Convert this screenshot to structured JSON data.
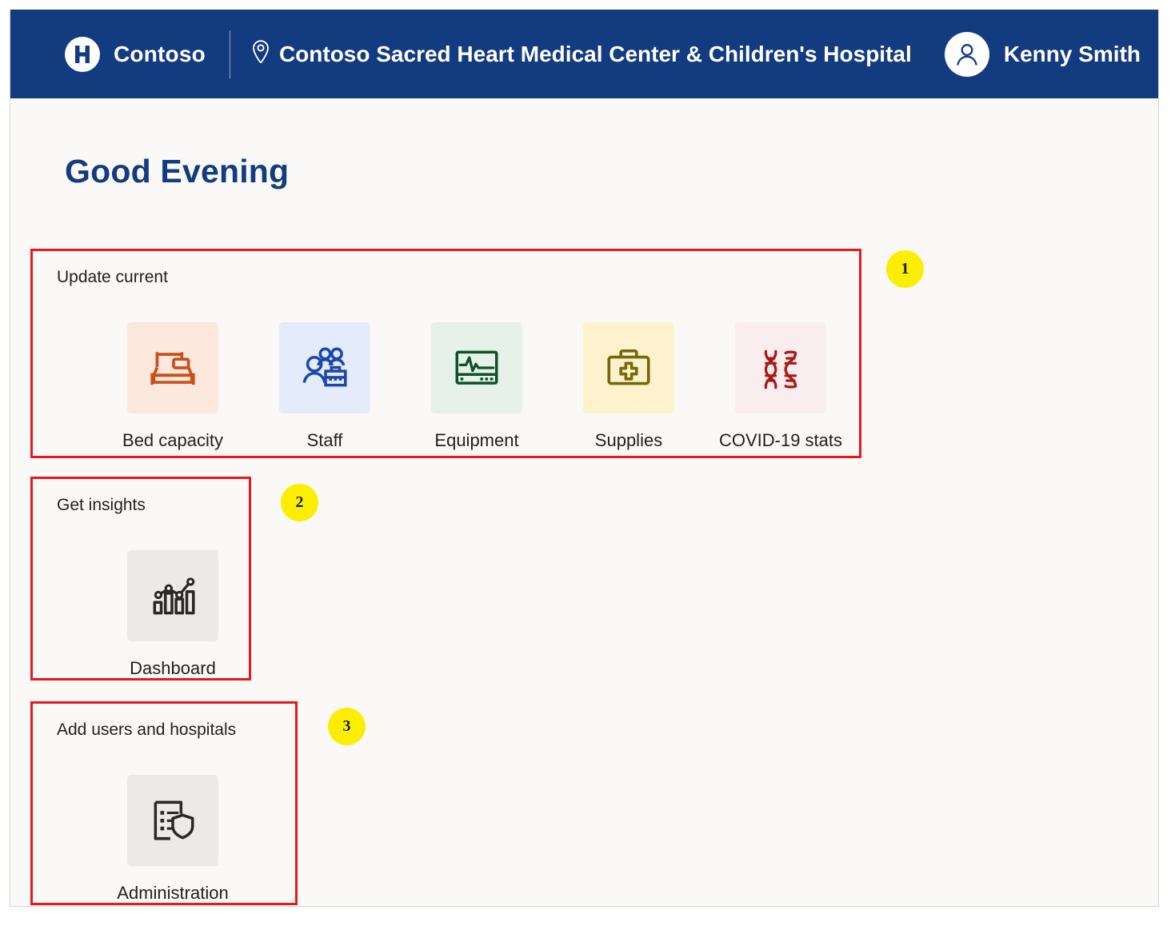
{
  "topbar": {
    "logo_icon": "hospital-h-logo-icon",
    "brand": "Contoso",
    "location_icon": "map-pin-icon",
    "facility": "Contoso Sacred Heart Medical Center & Children's Hospital",
    "avatar_icon": "person-avatar-icon",
    "user": "Kenny Smith",
    "bg_color": "#123b80"
  },
  "page": {
    "greeting": "Good Evening",
    "greeting_color": "#123b80",
    "bg_color": "#faf9f8"
  },
  "sections": [
    {
      "title": "Update current",
      "tiles": [
        {
          "label": "Bed capacity",
          "icon": "hospital-bed-icon",
          "icon_color": "#c8511b",
          "tile_color": "#fce8dc"
        },
        {
          "label": "Staff",
          "icon": "staff-people-icon",
          "icon_color": "#1b47a8",
          "tile_color": "#e4ebfa"
        },
        {
          "label": "Equipment",
          "icon": "vitals-monitor-icon",
          "icon_color": "#0d5227",
          "tile_color": "#e6f1ea"
        },
        {
          "label": "Supplies",
          "icon": "medical-kit-icon",
          "icon_color": "#77680a",
          "tile_color": "#fcf2cd"
        },
        {
          "label": "COVID-19 stats",
          "icon": "dna-helix-icon",
          "icon_color": "#a81a17",
          "tile_color": "#faeded"
        }
      ]
    },
    {
      "title": "Get insights",
      "tiles": [
        {
          "label": "Dashboard",
          "icon": "bar-chart-trend-icon",
          "icon_color": "#292827",
          "tile_color": "#eceae8"
        }
      ]
    },
    {
      "title": "Add users and hospitals",
      "tiles": [
        {
          "label": "Administration",
          "icon": "checklist-shield-icon",
          "icon_color": "#292827",
          "tile_color": "#eceae8"
        }
      ]
    }
  ],
  "annotations": {
    "box_color": "#e8191b",
    "badge_color": "#fcee02",
    "badges": [
      {
        "label": "1"
      },
      {
        "label": "2"
      },
      {
        "label": "3"
      }
    ]
  }
}
